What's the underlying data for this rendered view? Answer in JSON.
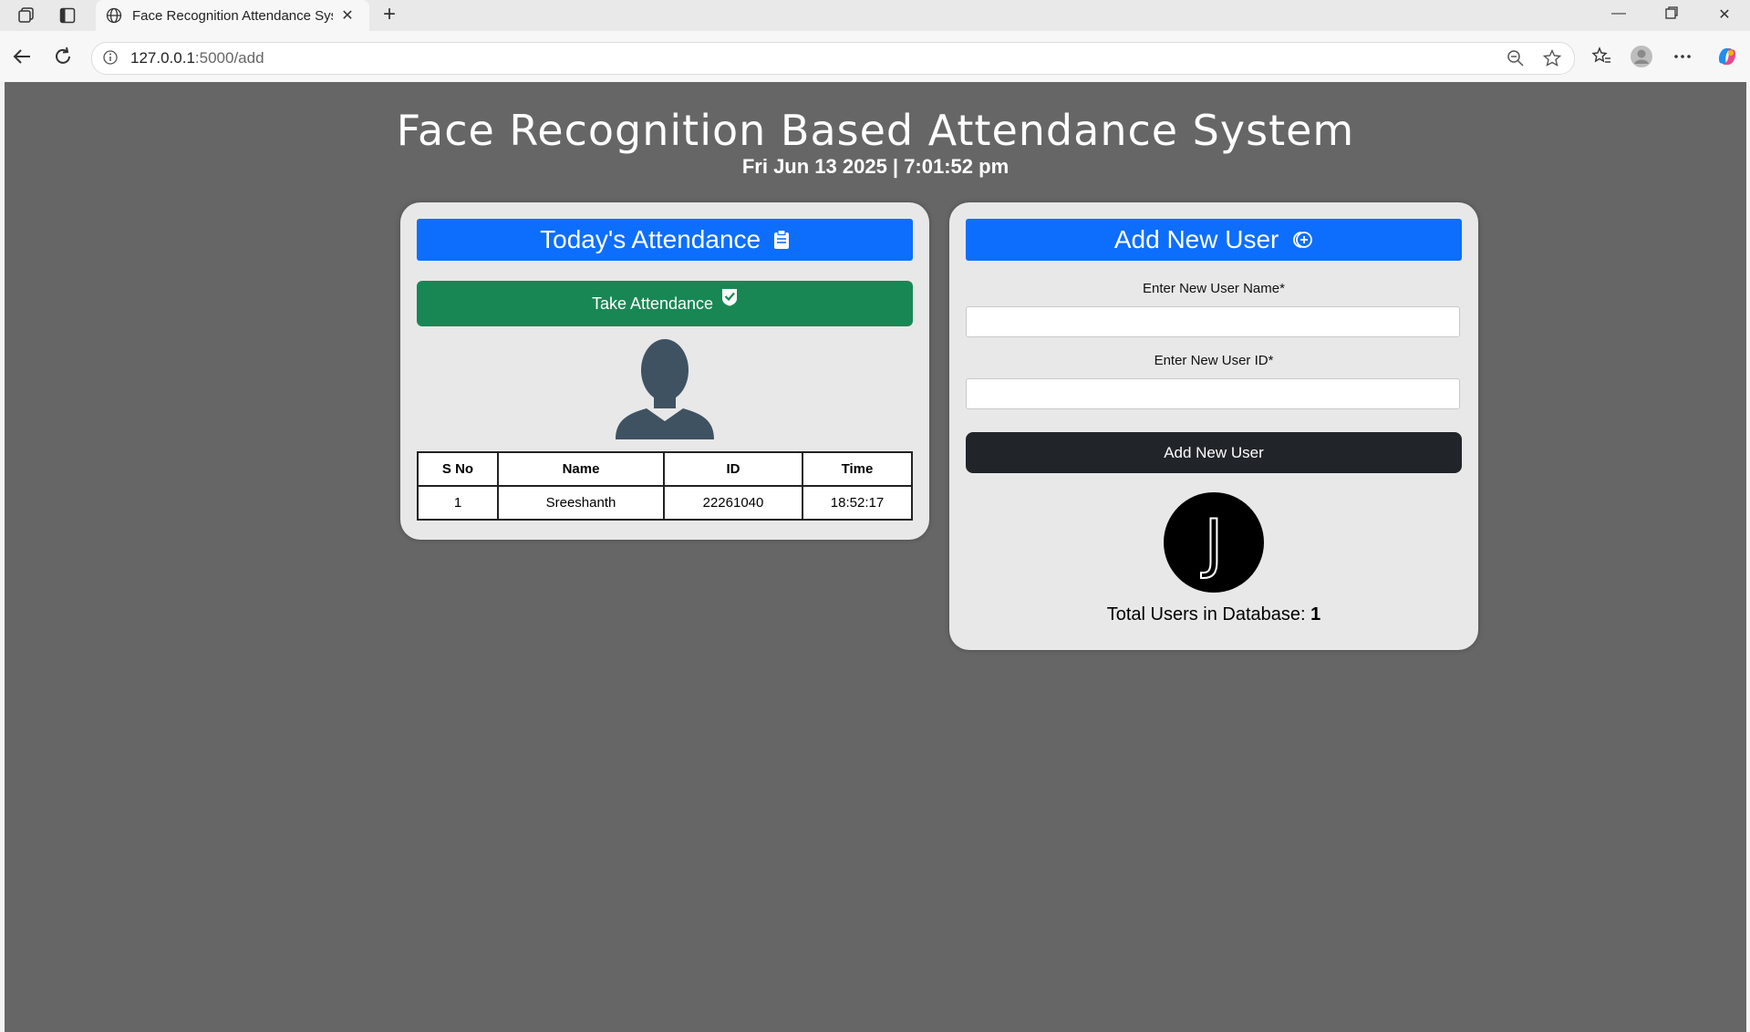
{
  "browser": {
    "tab_title": "Face Recognition Attendance Syst",
    "url_host": "127.0.0.1",
    "url_rest": ":5000/add"
  },
  "page": {
    "title": "Face Recognition Based Attendance System",
    "datetime": "Fri Jun 13 2025 | 7:01:52 pm"
  },
  "attendance": {
    "header": "Today's Attendance",
    "take_button": "Take Attendance",
    "columns": [
      "S No",
      "Name",
      "ID",
      "Time"
    ],
    "rows": [
      [
        "1",
        "Sreeshanth",
        "22261040",
        "18:52:17"
      ]
    ]
  },
  "add_user": {
    "header": "Add New User",
    "name_label": "Enter New User Name*",
    "name_value": "",
    "id_label": "Enter New User ID*",
    "id_value": "",
    "submit_label": "Add New User",
    "avatar_letter": "J",
    "total_label": "Total Users in Database:",
    "total_count": "1"
  },
  "colors": {
    "primary": "#0d6efd",
    "success": "#198754",
    "dark": "#212529",
    "page_bg": "#666666",
    "card_bg": "#e8e8e8"
  }
}
